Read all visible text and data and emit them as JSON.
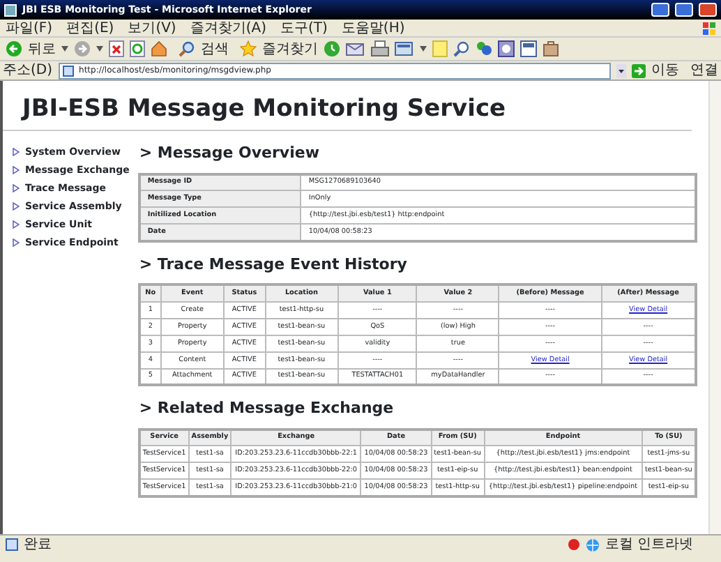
{
  "window": {
    "title": "JBI ESB Monitoring Test - Microsoft Internet Explorer"
  },
  "menu": [
    "파일(F)",
    "편집(E)",
    "보기(V)",
    "즐겨찾기(A)",
    "도구(T)",
    "도움말(H)"
  ],
  "toolbar": {
    "back_label": "뒤로",
    "search_label": "검색",
    "favorites_label": "즐겨찾기"
  },
  "address": {
    "label": "주소(D)",
    "url": "http://localhost/esb/monitoring/msgdview.php",
    "go_label": "이동",
    "links_label": "연결"
  },
  "page": {
    "title": "JBI-ESB Message Monitoring Service",
    "sidebar": [
      "System Overview",
      "Message Exchange",
      "Trace Message",
      "Service Assembly",
      "Service Unit",
      "Service Endpoint"
    ],
    "overview": {
      "heading": "> Message Overview",
      "fields": [
        {
          "label": "Message ID",
          "value": "MSG1270689103640"
        },
        {
          "label": "Message Type",
          "value": "InOnly"
        },
        {
          "label": "Initilized Location",
          "value": "{http://test.jbi.esb/test1} http:endpoint"
        },
        {
          "label": "Date",
          "value": "10/04/08 00:58:23"
        }
      ]
    },
    "trace": {
      "heading": "> Trace Message Event History",
      "columns": [
        "No",
        "Event",
        "Status",
        "Location",
        "Value 1",
        "Value 2",
        "(Before) Message",
        "(After) Message"
      ],
      "rows": [
        [
          {
            "text": "1"
          },
          {
            "text": "Create"
          },
          {
            "text": "ACTIVE"
          },
          {
            "text": "test1-http-su"
          },
          {
            "text": "----"
          },
          {
            "text": "----"
          },
          {
            "text": "----"
          },
          {
            "text": "View Detail",
            "kind": "link"
          }
        ],
        [
          {
            "text": "2"
          },
          {
            "text": "Property"
          },
          {
            "text": "ACTIVE"
          },
          {
            "text": "test1-bean-su"
          },
          {
            "text": "QoS"
          },
          {
            "text": "(low) High"
          },
          {
            "text": "----"
          },
          {
            "text": "----"
          }
        ],
        [
          {
            "text": "3"
          },
          {
            "text": "Property"
          },
          {
            "text": "ACTIVE"
          },
          {
            "text": "test1-bean-su"
          },
          {
            "text": "validity"
          },
          {
            "text": "true"
          },
          {
            "text": "----"
          },
          {
            "text": "----"
          }
        ],
        [
          {
            "text": "4"
          },
          {
            "text": "Content"
          },
          {
            "text": "ACTIVE"
          },
          {
            "text": "test1-bean-su"
          },
          {
            "text": "----"
          },
          {
            "text": "----"
          },
          {
            "text": "View Detail",
            "kind": "link"
          },
          {
            "text": "View Detail",
            "kind": "link"
          }
        ],
        [
          {
            "text": "5"
          },
          {
            "text": "Attachment"
          },
          {
            "text": "ACTIVE"
          },
          {
            "text": "test1-bean-su"
          },
          {
            "text": "TESTATTACH01"
          },
          {
            "text": "myDataHandler"
          },
          {
            "text": "----"
          },
          {
            "text": "----"
          }
        ]
      ]
    },
    "related": {
      "heading": "> Related Message Exchange",
      "columns": [
        "Service",
        "Assembly",
        "Exchange",
        "Date",
        "From (SU)",
        "Endpoint",
        "To (SU)"
      ],
      "rows": [
        [
          {
            "text": "TestService1"
          },
          {
            "text": "test1-sa"
          },
          {
            "text": "ID:203.253.23.6-11ccdb30bbb-22:1"
          },
          {
            "text": "10/04/08 00:58:23"
          },
          {
            "text": "test1-bean-su"
          },
          {
            "text": "{http://test.jbi.esb/test1} jms:endpoint"
          },
          {
            "text": "test1-jms-su"
          }
        ],
        [
          {
            "text": "TestService1"
          },
          {
            "text": "test1-sa"
          },
          {
            "text": "ID:203.253.23.6-11ccdb30bbb-22:0"
          },
          {
            "text": "10/04/08 00:58:23"
          },
          {
            "text": "test1-eip-su"
          },
          {
            "text": "{http://test.jbi.esb/test1} bean:endpoint"
          },
          {
            "text": "test1-bean-su"
          }
        ],
        [
          {
            "text": "TestService1"
          },
          {
            "text": "test1-sa"
          },
          {
            "text": "ID:203.253.23.6-11ccdb30bbb-21:0"
          },
          {
            "text": "10/04/08 00:58:23"
          },
          {
            "text": "test1-http-su"
          },
          {
            "text": "{http://test.jbi.esb/test1} pipeline:endpoint"
          },
          {
            "text": "test1-eip-su"
          }
        ]
      ]
    }
  },
  "status_bar": {
    "text": "완료",
    "zone": "로컬 인트라넷"
  }
}
